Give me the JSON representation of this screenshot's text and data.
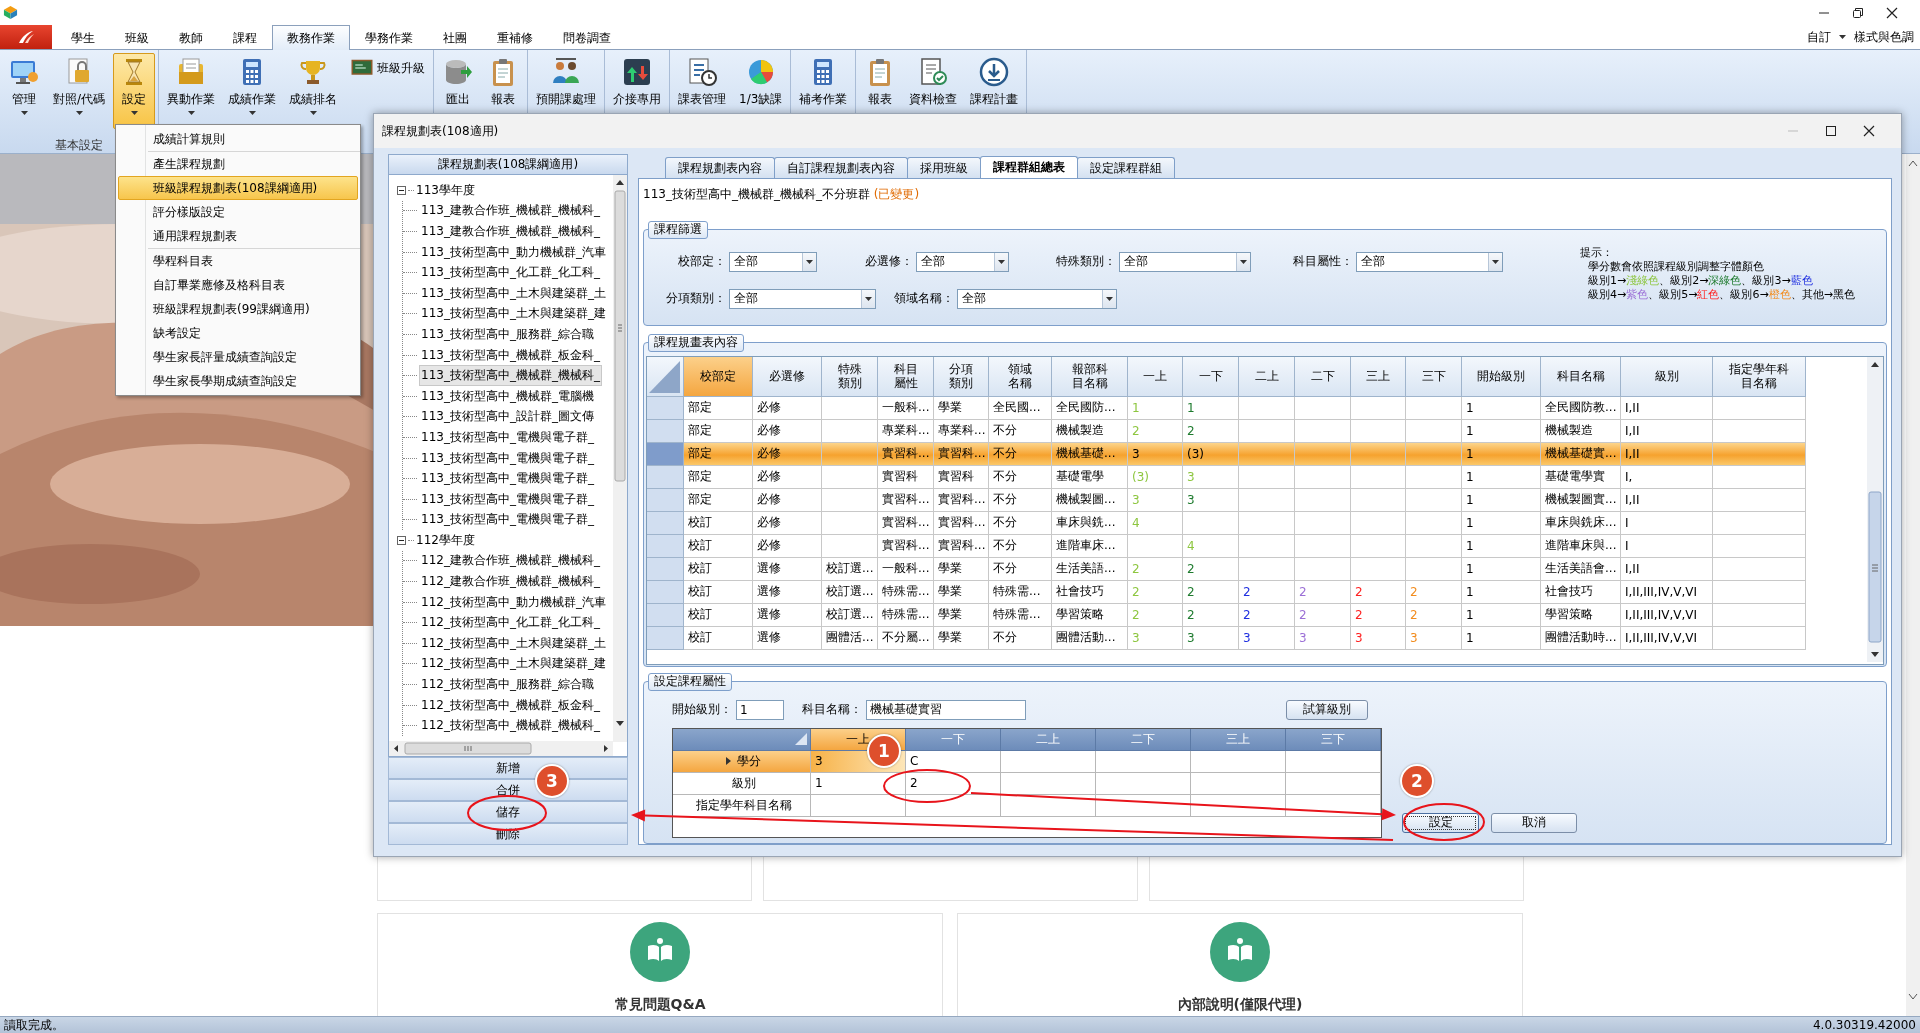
{
  "ribbon": {
    "tabs": [
      {
        "label": "學生",
        "selected": false
      },
      {
        "label": "班級",
        "selected": false
      },
      {
        "label": "教師",
        "selected": false
      },
      {
        "label": "課程",
        "selected": false
      },
      {
        "label": "教務作業",
        "selected": true
      },
      {
        "label": "學務作業",
        "selected": false
      },
      {
        "label": "社團",
        "selected": false
      },
      {
        "label": "重補修",
        "selected": false
      },
      {
        "label": "問卷調查",
        "selected": false
      }
    ],
    "quick_access": "自訂",
    "style_menu": "樣式與色調",
    "groups": [
      {
        "label": "基本設定",
        "buttons": [
          {
            "label": "管理",
            "kind": "large",
            "dropdown": true,
            "pressed": false
          },
          {
            "label": "對照/代碼",
            "kind": "large",
            "dropdown": true,
            "pressed": false
          },
          {
            "label": "設定",
            "kind": "large",
            "dropdown": true,
            "pressed": true
          }
        ]
      },
      {
        "buttons": [
          {
            "label": "異動作業",
            "kind": "large",
            "dropdown": true,
            "pressed": false
          },
          {
            "label": "成績作業",
            "kind": "large",
            "dropdown": true,
            "pressed": false
          },
          {
            "label": "成績排名",
            "kind": "large",
            "dropdown": true,
            "pressed": false
          },
          {
            "label": "班級升級",
            "kind": "small",
            "dropdown": false,
            "pressed": false
          }
        ]
      },
      {
        "buttons": [
          {
            "label": "匯出",
            "kind": "large",
            "dropdown": false,
            "pressed": false
          },
          {
            "label": "報表",
            "kind": "large",
            "dropdown": false,
            "pressed": false
          }
        ]
      },
      {
        "buttons": [
          {
            "label": "預開課處理",
            "kind": "large",
            "dropdown": false,
            "pressed": false
          }
        ]
      },
      {
        "buttons": [
          {
            "label": "介接專用",
            "kind": "large",
            "dropdown": false,
            "pressed": false
          }
        ]
      },
      {
        "buttons": [
          {
            "label": "課表管理",
            "kind": "large",
            "dropdown": false,
            "pressed": false
          },
          {
            "label": "1/3缺課",
            "kind": "large",
            "dropdown": false,
            "pressed": false
          }
        ]
      },
      {
        "buttons": [
          {
            "label": "補考作業",
            "kind": "large",
            "dropdown": false,
            "pressed": false
          }
        ]
      },
      {
        "buttons": [
          {
            "label": "報表",
            "kind": "large",
            "dropdown": false,
            "pressed": false
          },
          {
            "label": "資料檢查",
            "kind": "large",
            "dropdown": false,
            "pressed": false
          },
          {
            "label": "課程計畫",
            "kind": "large",
            "dropdown": false,
            "pressed": false
          }
        ]
      }
    ]
  },
  "settings_menu": {
    "groups": [
      {
        "items": [
          {
            "label": "成績計算規則",
            "selected": false
          }
        ]
      },
      {
        "items": [
          {
            "label": "產生課程規劃",
            "selected": false
          },
          {
            "label": "班級課程規劃表(108課綱適用)",
            "selected": true
          },
          {
            "label": "評分樣版設定",
            "selected": false
          },
          {
            "label": "通用課程規劃表",
            "selected": false
          }
        ]
      },
      {
        "items": [
          {
            "label": "學程科目表",
            "selected": false
          },
          {
            "label": "自訂畢業應修及格科目表",
            "selected": false
          },
          {
            "label": "班級課程規劃表(99課綱適用)",
            "selected": false
          },
          {
            "label": "缺考設定",
            "selected": false
          },
          {
            "label": "學生家長評量成績查詢設定",
            "selected": false
          },
          {
            "label": "學生家長學期成績查詢設定",
            "selected": false
          }
        ]
      }
    ]
  },
  "page": {
    "cards": [
      {
        "title": "常見問題Q&A"
      },
      {
        "title": "內部說明(僅限代理)"
      }
    ]
  },
  "dialog": {
    "title": "課程規劃表(108適用)",
    "plan_panel": {
      "header": "課程規劃表(108課綱適用)",
      "tree": [
        {
          "label": "113學年度",
          "expanded": true,
          "children": [
            {
              "label": "113_建教合作班_機械群_機械科_",
              "selected": false
            },
            {
              "label": "113_建教合作班_機械群_機械科_",
              "selected": false
            },
            {
              "label": "113_技術型高中_動力機械群_汽車",
              "selected": false
            },
            {
              "label": "113_技術型高中_化工群_化工科_",
              "selected": false
            },
            {
              "label": "113_技術型高中_土木與建築群_土",
              "selected": false
            },
            {
              "label": "113_技術型高中_土木與建築群_建",
              "selected": false
            },
            {
              "label": "113_技術型高中_服務群_綜合職",
              "selected": false
            },
            {
              "label": "113_技術型高中_機械群_板金科_",
              "selected": false
            },
            {
              "label": "113_技術型高中_機械群_機械科_",
              "selected": true
            },
            {
              "label": "113_技術型高中_機械群_電腦機",
              "selected": false
            },
            {
              "label": "113_技術型高中_設計群_圖文傳",
              "selected": false
            },
            {
              "label": "113_技術型高中_電機與電子群_",
              "selected": false
            },
            {
              "label": "113_技術型高中_電機與電子群_",
              "selected": false
            },
            {
              "label": "113_技術型高中_電機與電子群_",
              "selected": false
            },
            {
              "label": "113_技術型高中_電機與電子群_",
              "selected": false
            },
            {
              "label": "113_技術型高中_電機與電子群_",
              "selected": false
            }
          ]
        },
        {
          "label": "112學年度",
          "expanded": true,
          "children": [
            {
              "label": "112_建教合作班_機械群_機械科_",
              "selected": false
            },
            {
              "label": "112_建教合作班_機械群_機械科_",
              "selected": false
            },
            {
              "label": "112_技術型高中_動力機械群_汽車",
              "selected": false
            },
            {
              "label": "112_技術型高中_化工群_化工科_",
              "selected": false
            },
            {
              "label": "112_技術型高中_土木與建築群_土",
              "selected": false
            },
            {
              "label": "112_技術型高中_土木與建築群_建",
              "selected": false
            },
            {
              "label": "112_技術型高中_服務群_綜合職",
              "selected": false
            },
            {
              "label": "112_技術型高中_機械群_板金科_",
              "selected": false
            },
            {
              "label": "112_技術型高中_機械群_機械科_",
              "selected": false
            }
          ]
        }
      ],
      "buttons": [
        "新增",
        "合併",
        "儲存",
        "刪除"
      ]
    },
    "tabs": [
      {
        "label": "課程規劃表內容",
        "selected": false
      },
      {
        "label": "自訂課程規劃表內容",
        "selected": false
      },
      {
        "label": "採用班級",
        "selected": false
      },
      {
        "label": "課程群組總表",
        "selected": true
      },
      {
        "label": "設定課程群組",
        "selected": false
      }
    ],
    "plan": {
      "name": "113_技術型高中_機械群_機械科_不分班群",
      "state": "(已變更)"
    },
    "filter": {
      "title": "課程篩選",
      "fields": [
        {
          "label": "校部定：",
          "value": "全部"
        },
        {
          "label": "必選修：",
          "value": "全部"
        },
        {
          "label": "特殊類別：",
          "value": "全部"
        },
        {
          "label": "科目屬性：",
          "value": "全部"
        },
        {
          "label": "分項類別：",
          "value": "全部"
        },
        {
          "label": "領域名稱：",
          "value": "全部"
        }
      ],
      "hint": {
        "title": "提示：",
        "lines": [
          [
            {
              "text": "學分數會依照課程級別調整字體顏色"
            }
          ],
          [
            {
              "text": "級別1→"
            },
            {
              "text": "淺綠色",
              "color": "#8dc63f"
            },
            {
              "text": "、級別2→"
            },
            {
              "text": "深綠色",
              "color": "#1e7b2e"
            },
            {
              "text": "、級別3→"
            },
            {
              "text": "藍色",
              "color": "#1f2fe0"
            }
          ],
          [
            {
              "text": "級別4→"
            },
            {
              "text": "紫色",
              "color": "#9b6fd6"
            },
            {
              "text": "、級別5→"
            },
            {
              "text": "紅色",
              "color": "#ff2020"
            },
            {
              "text": "、級別6→"
            },
            {
              "text": "橙色",
              "color": "#f28c1e"
            },
            {
              "text": "、其他→"
            },
            {
              "text": "黑色",
              "color": "#000000"
            }
          ]
        ]
      }
    },
    "grid": {
      "title": "課程規畫表內容",
      "columns": [
        {
          "label": "校部定",
          "selected": true
        },
        {
          "label": "必選修",
          "selected": false
        },
        {
          "label": "特殊類別",
          "selected": false
        },
        {
          "label": "科目屬性",
          "selected": false
        },
        {
          "label": "分項類別",
          "selected": false
        },
        {
          "label": "領域名稱",
          "selected": false
        },
        {
          "label": "報部科目名稱",
          "selected": false
        },
        {
          "label": "一上",
          "selected": false
        },
        {
          "label": "一下",
          "selected": false
        },
        {
          "label": "二上",
          "selected": false
        },
        {
          "label": "二下",
          "selected": false
        },
        {
          "label": "三上",
          "selected": false
        },
        {
          "label": "三下",
          "selected": false
        },
        {
          "label": "開始級別",
          "selected": false
        },
        {
          "label": "科目名稱",
          "selected": false
        },
        {
          "label": "級別",
          "selected": false
        },
        {
          "label": "指定學年科目名稱",
          "selected": false
        }
      ],
      "rows": [
        {
          "selected": false,
          "school_or_dept": "部定",
          "required_elective": "必修",
          "subject_attribute": "一般科...",
          "subcategory": "學業",
          "domain": "全民國...",
          "reported_subject": "全民國防...",
          "credits": {
            "y1_fall": {
              "text": "1",
              "color": "#8dc63f"
            },
            "y1_spring": {
              "text": "1",
              "color": "#1e7b2e"
            }
          },
          "start_level": "1",
          "subject": "全民國防教...",
          "levels": "I,II"
        },
        {
          "selected": false,
          "school_or_dept": "部定",
          "required_elective": "必修",
          "subject_attribute": "專業科...",
          "subcategory": "專業科...",
          "domain": "不分",
          "reported_subject": "機械製造",
          "credits": {
            "y1_fall": {
              "text": "2",
              "color": "#8dc63f"
            },
            "y1_spring": {
              "text": "2",
              "color": "#1e7b2e"
            }
          },
          "start_level": "1",
          "subject": "機械製造",
          "levels": "I,II"
        },
        {
          "selected": true,
          "school_or_dept": "部定",
          "required_elective": "必修",
          "subject_attribute": "實習科...",
          "subcategory": "實習科...",
          "domain": "不分",
          "reported_subject": "機械基礎...",
          "credits": {
            "y1_fall": {
              "text": "3"
            },
            "y1_spring": {
              "text": "(3)"
            }
          },
          "start_level": "1",
          "subject": "機械基礎實...",
          "levels": "I,II"
        },
        {
          "selected": false,
          "school_or_dept": "部定",
          "required_elective": "必修",
          "subject_attribute": "實習科",
          "subcategory": "實習科",
          "domain": "不分",
          "reported_subject": "基礎電學",
          "credits": {
            "y1_fall": {
              "text": "(3)",
              "color": "#8dc63f"
            },
            "y1_spring": {
              "text": "3",
              "color": "#8dc63f"
            }
          },
          "start_level": "1",
          "subject": "基礎電學實",
          "levels": "I,"
        },
        {
          "selected": false,
          "school_or_dept": "部定",
          "required_elective": "必修",
          "subject_attribute": "實習科...",
          "subcategory": "實習科...",
          "domain": "不分",
          "reported_subject": "機械製圖...",
          "credits": {
            "y1_fall": {
              "text": "3",
              "color": "#8dc63f"
            },
            "y1_spring": {
              "text": "3",
              "color": "#1e7b2e"
            }
          },
          "start_level": "1",
          "subject": "機械製圖實...",
          "levels": "I,II"
        },
        {
          "selected": false,
          "school_or_dept": "校訂",
          "required_elective": "必修",
          "subject_attribute": "實習科...",
          "subcategory": "實習科...",
          "domain": "不分",
          "reported_subject": "車床與銑...",
          "credits": {
            "y1_fall": {
              "text": "4",
              "color": "#8dc63f"
            }
          },
          "start_level": "1",
          "subject": "車床與銑床...",
          "levels": "I"
        },
        {
          "selected": false,
          "school_or_dept": "校訂",
          "required_elective": "必修",
          "subject_attribute": "實習科...",
          "subcategory": "實習科...",
          "domain": "不分",
          "reported_subject": "進階車床...",
          "credits": {
            "y1_spring": {
              "text": "4",
              "color": "#8dc63f"
            }
          },
          "start_level": "1",
          "subject": "進階車床與...",
          "levels": "I"
        },
        {
          "selected": false,
          "school_or_dept": "校訂",
          "required_elective": "選修",
          "special_category": "校訂選...",
          "subject_attribute": "一般科...",
          "subcategory": "學業",
          "domain": "不分",
          "reported_subject": "生活美語...",
          "credits": {
            "y1_fall": {
              "text": "2",
              "color": "#8dc63f"
            },
            "y1_spring": {
              "text": "2",
              "color": "#1e7b2e"
            }
          },
          "start_level": "1",
          "subject": "生活美語會...",
          "levels": "I,II"
        },
        {
          "selected": false,
          "school_or_dept": "校訂",
          "required_elective": "選修",
          "special_category": "校訂選...",
          "subject_attribute": "特殊需...",
          "subcategory": "學業",
          "domain": "特殊需...",
          "reported_subject": "社會技巧",
          "credits": {
            "y1_fall": {
              "text": "2",
              "color": "#8dc63f"
            },
            "y1_spring": {
              "text": "2",
              "color": "#1e7b2e"
            },
            "y2_fall": {
              "text": "2",
              "color": "#1f2fe0"
            },
            "y2_spring": {
              "text": "2",
              "color": "#9b6fd6"
            },
            "y3_fall": {
              "text": "2",
              "color": "#ff2020"
            },
            "y3_spring": {
              "text": "2",
              "color": "#f28c1e"
            }
          },
          "start_level": "1",
          "subject": "社會技巧",
          "levels": "I,II,III,IV,V,VI"
        },
        {
          "selected": false,
          "school_or_dept": "校訂",
          "required_elective": "選修",
          "special_category": "校訂選...",
          "subject_attribute": "特殊需...",
          "subcategory": "學業",
          "domain": "特殊需...",
          "reported_subject": "學習策略",
          "credits": {
            "y1_fall": {
              "text": "2",
              "color": "#8dc63f"
            },
            "y1_spring": {
              "text": "2",
              "color": "#1e7b2e"
            },
            "y2_fall": {
              "text": "2",
              "color": "#1f2fe0"
            },
            "y2_spring": {
              "text": "2",
              "color": "#9b6fd6"
            },
            "y3_fall": {
              "text": "2",
              "color": "#ff2020"
            },
            "y3_spring": {
              "text": "2",
              "color": "#f28c1e"
            }
          },
          "start_level": "1",
          "subject": "學習策略",
          "levels": "I,II,III,IV,V,VI"
        },
        {
          "selected": false,
          "school_or_dept": "校訂",
          "required_elective": "選修",
          "special_category": "團體活...",
          "subject_attribute": "不分屬...",
          "subcategory": "學業",
          "domain": "不分",
          "reported_subject": "團體活動...",
          "credits": {
            "y1_fall": {
              "text": "3",
              "color": "#8dc63f"
            },
            "y1_spring": {
              "text": "3",
              "color": "#1e7b2e"
            },
            "y2_fall": {
              "text": "3",
              "color": "#1f2fe0"
            },
            "y2_spring": {
              "text": "3",
              "color": "#9b6fd6"
            },
            "y3_fall": {
              "text": "3",
              "color": "#ff2020"
            },
            "y3_spring": {
              "text": "3",
              "color": "#f28c1e"
            }
          },
          "start_level": "1",
          "subject": "團體活動時...",
          "levels": "I,II,III,IV,V,VI"
        }
      ]
    },
    "properties": {
      "title": "設定課程屬性",
      "fields": [
        {
          "label": "開始級別：",
          "value": "1"
        },
        {
          "label": "科目名稱：",
          "value": "機械基礎實習"
        }
      ],
      "calc_button": "試算級別",
      "columns": [
        {
          "label": "一上",
          "selected": true
        },
        {
          "label": "一下",
          "selected": false
        },
        {
          "label": "二上",
          "selected": false
        },
        {
          "label": "二下",
          "selected": false
        },
        {
          "label": "三上",
          "selected": false
        },
        {
          "label": "三下",
          "selected": false
        }
      ],
      "rows": [
        {
          "label": "學分",
          "selected": true,
          "values": [
            "3",
            "C"
          ]
        },
        {
          "label": "級別",
          "selected": false,
          "values": [
            "1",
            "2"
          ]
        },
        {
          "label": "指定學年科目名稱",
          "selected": false
        }
      ],
      "buttons": [
        {
          "label": "設定",
          "focused": true
        },
        {
          "label": "取消",
          "focused": false
        }
      ]
    }
  },
  "annotations": [
    {
      "number": "1"
    },
    {
      "number": "2"
    },
    {
      "number": "3"
    }
  ],
  "status_bar": {
    "message": "讀取完成。",
    "version": "4.0.30319.42000"
  }
}
